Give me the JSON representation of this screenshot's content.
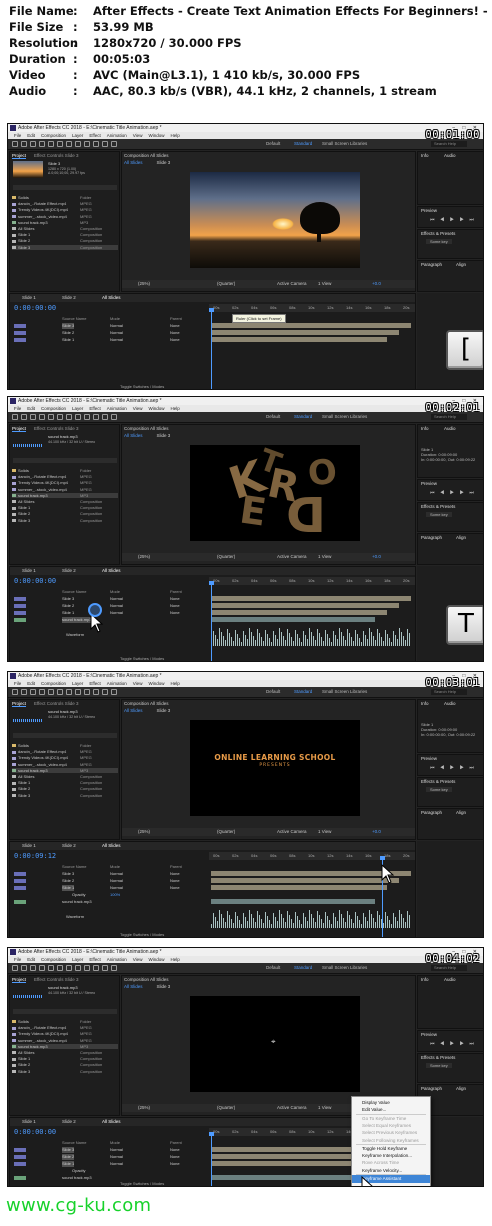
{
  "media_info": [
    {
      "key": "File Name",
      "value": "After Effects - Create Text Animation Effects For Beginners! - Maggie Osa"
    },
    {
      "key": "File Size",
      "value": "53.99 MB"
    },
    {
      "key": "Resolution",
      "value": "1280x720 / 30.000 FPS"
    },
    {
      "key": "Duration",
      "value": "00:05:03"
    },
    {
      "key": "Video",
      "value": "AVC (Main@L3.1), 1 410 kb/s, 30.000 FPS"
    },
    {
      "key": "Audio",
      "value": "AAC, 80.3 kb/s (VBR), 44.1 kHz, 2 channels, 1 stream"
    }
  ],
  "ui": {
    "window_title": "Adobe After Effects CC 2018 - E:\\Cinematic Title Animation.aep *",
    "menu": [
      "File",
      "Edit",
      "Composition",
      "Layer",
      "Effect",
      "Animation",
      "View",
      "Window",
      "Help"
    ],
    "workspaces": [
      "Default",
      "Standard",
      "Small Screen",
      "Libraries"
    ],
    "search_help": "Search Help",
    "project_tab": "Project",
    "effect_controls_tab": "Effect Controls Slide 3",
    "composition_tab": "Composition All Slides",
    "comp_tabs": [
      "All Slides",
      "Slide 3"
    ],
    "zoom": "(25%)",
    "resolution": "(Quarter)",
    "camera": "Active Camera",
    "view_count": "1 View",
    "timeline_tabs": [
      "Slide 1",
      "Slide 2",
      "All Slides"
    ],
    "layer_header": "Source Name",
    "mode_header": "Mode",
    "parent_header": "Parent",
    "mode_normal": "Normal",
    "parent_none": "None",
    "toggle_label": "Toggle Switches / Modes",
    "right_panels": {
      "info": "Info",
      "audio": "Audio",
      "preview": "Preview",
      "effects": "Effects & Presets",
      "effects_search": "Some key",
      "paragraph": "Paragraph",
      "align": "Align"
    },
    "project_items": [
      "Solids",
      "dancin_..Rotate Effect.mp4",
      "Trendy Videos 4K(DCI).mp4",
      "summer_..stock_video.mp4",
      "sound track.mp3",
      "All Slides",
      "Slide 1",
      "Slide 2",
      "Slide 3"
    ],
    "project_types": [
      "Folder",
      "MPEG",
      "MPEG",
      "MPEG",
      "MP3",
      "Composition",
      "Composition",
      "Composition",
      "Composition"
    ],
    "ruler_ticks": [
      "00s",
      "02s",
      "04s",
      "06s",
      "08s",
      "10s",
      "12s",
      "14s",
      "16s",
      "18s",
      "20s"
    ]
  },
  "frames": [
    {
      "timestamp": "00:01:00",
      "timecode": "0:00:00:00",
      "project_selected": "Slide 3",
      "project_meta": "1280 x 720 (1.00)\nΔ 0;00;10;00, 29.97 fps",
      "layers": [
        "Slide 3",
        "Slide 2",
        "Slide 1"
      ],
      "tooltip": "Ruler (Click to set Frame)",
      "key": "[",
      "info_lines": []
    },
    {
      "timestamp": "00:02:01",
      "timecode": "0:00:00:00",
      "project_selected": "sound track.mp3",
      "project_meta": "44.100 kHz / 32 bit U / Stereo",
      "layers": [
        "Slide 3",
        "Slide 2",
        "Slide 1",
        "sound track.mp3"
      ],
      "sub_property": "Waveform",
      "key": "T",
      "info_lines": [
        "Slide 1",
        "Duration: 0:00:09:00",
        "In: 0:00:00:00, Out: 0:00:09:22"
      ],
      "viewer_text": "K R D"
    },
    {
      "timestamp": "00:03:01",
      "timecode": "0:00:09:12",
      "project_selected": "sound track.mp3",
      "project_meta": "44.100 kHz / 32 bit U / Stereo",
      "layers": [
        "Slide 3",
        "Slide 2",
        "Slide 1",
        "sound track.mp3"
      ],
      "sub_property": "Waveform",
      "opacity_label": "Opacity",
      "opacity_value": "100%",
      "viewer_title": "ONLINE LEARNING SCHOOL",
      "viewer_subtitle": "PRESENTS",
      "info_lines": [
        "Slide 1",
        "Duration: 0:00:09:00",
        "In: 0:00:00:00, Out: 0:00:09:22"
      ]
    },
    {
      "timestamp": "00:04:02",
      "timecode": "0:00:00:00",
      "project_selected": "sound track.mp3",
      "project_meta": "44.100 kHz / 32 bit U / Stereo",
      "layers": [
        "Slide 3",
        "Slide 2",
        "Slide 1",
        "sound track.mp3"
      ],
      "sub_property": "Waveform",
      "opacity_label": "Opacity",
      "context_menu": [
        {
          "label": "Display Value",
          "state": "normal"
        },
        {
          "label": "Edit Value...",
          "state": "normal"
        },
        {
          "label": "Go To Keyframe Time",
          "state": "disabled"
        },
        {
          "label": "Select Equal Keyframes",
          "state": "disabled"
        },
        {
          "label": "Select Previous Keyframes",
          "state": "disabled"
        },
        {
          "label": "Select Following Keyframes",
          "state": "disabled"
        },
        {
          "label": "Toggle Hold Keyframe",
          "state": "normal"
        },
        {
          "label": "Keyframe Interpolation...",
          "state": "normal"
        },
        {
          "label": "Rove Across Time",
          "state": "disabled"
        },
        {
          "label": "Keyframe Velocity...",
          "state": "normal"
        },
        {
          "label": "Keyframe Assistant",
          "state": "highlight"
        }
      ]
    }
  ],
  "watermark": "www.cg-ku.com",
  "colors": {
    "accent": "#4e9bff",
    "watermark": "#17d22b",
    "keyframe_bar": "#8d8672",
    "waveform": "#a9c2c2"
  }
}
